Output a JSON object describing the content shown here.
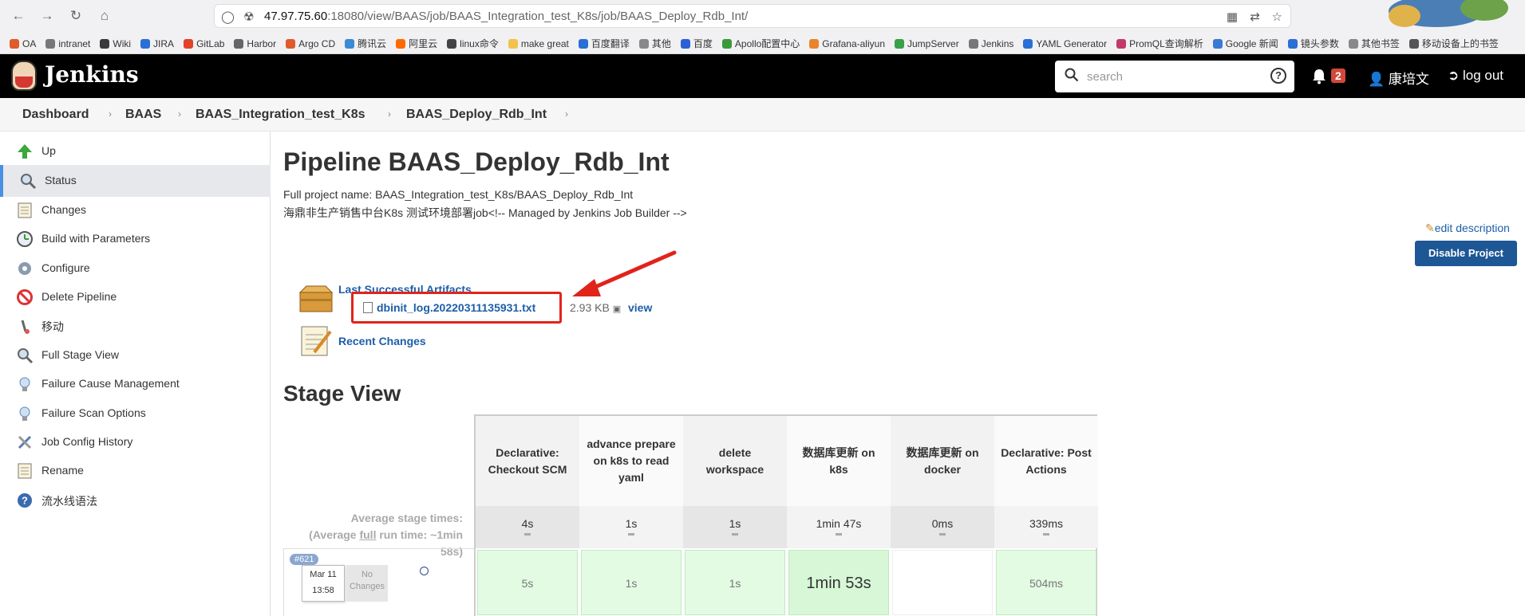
{
  "browser": {
    "url_host": "47.97.75.60",
    "url_rest": ":18080/view/BAAS/job/BAAS_Integration_test_K8s/job/BAAS_Deploy_Rdb_Int/",
    "bookmarks": [
      "OA",
      "intranet",
      "Wiki",
      "JIRA",
      "GitLab",
      "Harbor",
      "Argo CD",
      "腾讯云",
      "阿里云",
      "linux命令",
      "make great",
      "百度翻译",
      "其他",
      "百度",
      "Apollo配置中心",
      "Grafana-aliyun",
      "JumpServer",
      "Jenkins",
      "YAML Generator",
      "PromQL查询解析",
      "Google 新闻",
      "镜头参数",
      "其他书签",
      "移动设备上的书签"
    ]
  },
  "header": {
    "logo_text": "Jenkins",
    "search_placeholder": "search",
    "help_label": "?",
    "notification_count": "2",
    "user_name": "康培文",
    "logout_label": "log out"
  },
  "breadcrumb": [
    "Dashboard",
    "BAAS",
    "BAAS_Integration_test_K8s",
    "BAAS_Deploy_Rdb_Int"
  ],
  "sidebar": {
    "items": [
      {
        "label": "Up",
        "icon": "up-arrow-icon"
      },
      {
        "label": "Status",
        "icon": "magnifier-icon"
      },
      {
        "label": "Changes",
        "icon": "notepad-icon"
      },
      {
        "label": "Build with Parameters",
        "icon": "clock-icon"
      },
      {
        "label": "Configure",
        "icon": "gear-icon"
      },
      {
        "label": "Delete Pipeline",
        "icon": "no-entry-icon"
      },
      {
        "label": "移动",
        "icon": "move-icon"
      },
      {
        "label": "Full Stage View",
        "icon": "magnifier-icon"
      },
      {
        "label": "Failure Cause Management",
        "icon": "bulb-icon"
      },
      {
        "label": "Failure Scan Options",
        "icon": "bulb-icon"
      },
      {
        "label": "Job Config History",
        "icon": "tools-icon"
      },
      {
        "label": "Rename",
        "icon": "notepad-icon"
      },
      {
        "label": "流水线语法",
        "icon": "help-icon"
      }
    ],
    "active_index": 1
  },
  "main": {
    "title": "Pipeline BAAS_Deploy_Rdb_Int",
    "full_name": "Full project name: BAAS_Integration_test_K8s/BAAS_Deploy_Rdb_Int",
    "description": "海鼎非生产销售中台K8s 测试环境部署job<!-- Managed by Jenkins Job Builder -->",
    "edit_description": "edit description",
    "disable_button": "Disable Project",
    "artifacts_label": "Last Successful Artifacts",
    "artifact_file": "dbinit_log.20220311135931.txt",
    "artifact_size": "2.93 KB",
    "artifact_view": "view",
    "recent_changes": "Recent Changes",
    "stage_view_title": "Stage View"
  },
  "stage_view": {
    "avg_label_1": "Average stage times:",
    "avg_label_2a": "(Average ",
    "avg_label_2u": "full",
    "avg_label_2b": " run time: ~1min",
    "avg_label_3": "58s)",
    "stages": [
      {
        "name": "Declarative: Checkout SCM",
        "avg": "4s",
        "build": "5s"
      },
      {
        "name": "advance prepare on k8s to read yaml",
        "avg": "1s",
        "build": "1s"
      },
      {
        "name": "delete workspace",
        "avg": "1s",
        "build": "1s"
      },
      {
        "name": "数据库更新 on k8s",
        "avg": "1min 47s",
        "build": "1min 53s"
      },
      {
        "name": "数据库更新 on docker",
        "avg": "0ms",
        "build": ""
      },
      {
        "name": "Declarative: Post Actions",
        "avg": "339ms",
        "build": "504ms"
      }
    ],
    "build": {
      "number": "#621",
      "date": "Mar 11",
      "time": "13:58",
      "no_changes": "No Changes"
    }
  },
  "colors": {
    "header_bg": "#000000",
    "link": "#1d5ea8",
    "button": "#1e5795",
    "highlight_box": "#e0241b",
    "stage_success": "#e3fbe3"
  }
}
